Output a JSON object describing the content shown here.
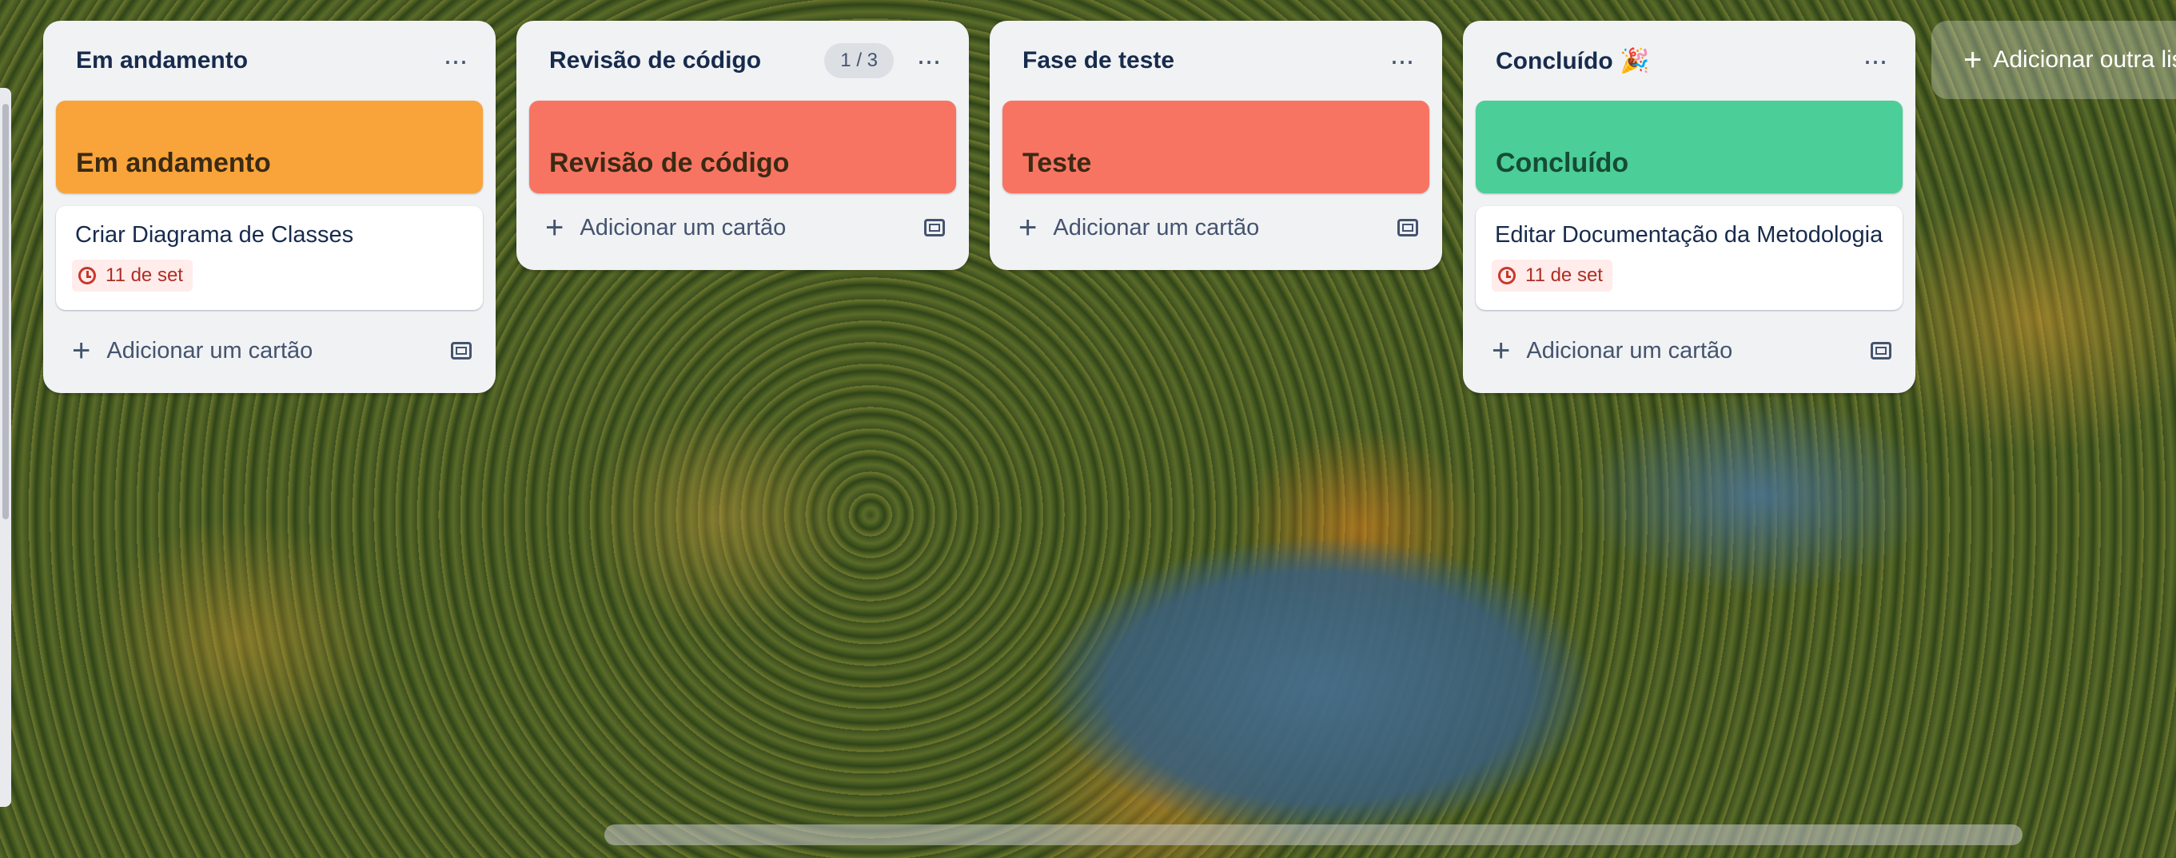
{
  "lists": [
    {
      "title": "Em andamento",
      "cover_label": "Em andamento",
      "cover_color": "#f8a43a",
      "cards": [
        {
          "title": "Criar Diagrama de Classes",
          "due": "11 de set"
        }
      ],
      "add_card_label": "Adicionar um cartão"
    },
    {
      "title": "Revisão de código",
      "count_badge": "1 / 3",
      "cover_label": "Revisão de código",
      "cover_color": "#f87462",
      "cards": [],
      "add_card_label": "Adicionar um cartão"
    },
    {
      "title": "Fase de teste",
      "cover_label": "Teste",
      "cover_color": "#f87462",
      "cards": [],
      "add_card_label": "Adicionar um cartão"
    },
    {
      "title": "Concluído 🎉",
      "cover_label": "Concluído",
      "cover_color": "#4bce97",
      "cards": [
        {
          "title": "Editar Documentação da Metodologia",
          "due": "11 de set"
        }
      ],
      "add_card_label": "Adicionar um cartão"
    }
  ],
  "add_list_label": "Adicionar outra lista",
  "icons": {
    "more": "more-horizontal-icon",
    "plus": "plus-icon",
    "template": "card-template-icon",
    "clock": "clock-icon"
  }
}
